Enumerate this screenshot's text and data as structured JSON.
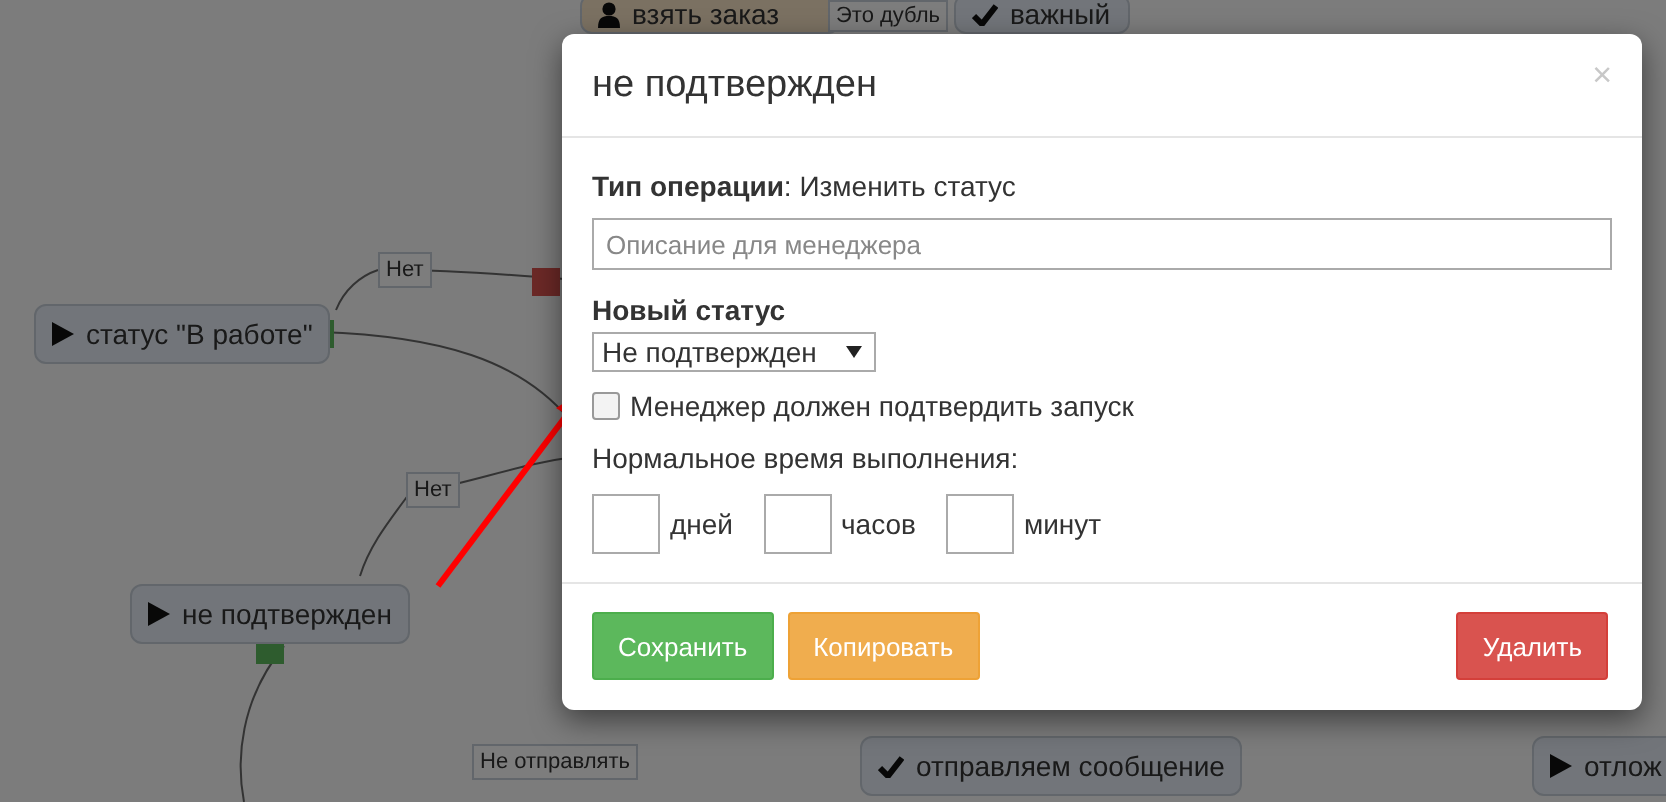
{
  "canvas": {
    "nodes": [
      {
        "kind": "user",
        "label": "взять заказ"
      },
      {
        "kind": "tag",
        "label": "Это дубль"
      },
      {
        "kind": "check",
        "label": "важный"
      },
      {
        "kind": "tag",
        "label": "Нет"
      },
      {
        "kind": "play",
        "label": "статус \"В работе\""
      },
      {
        "kind": "tag",
        "label": "Нет"
      },
      {
        "kind": "play",
        "label": "не подтвержден"
      },
      {
        "kind": "tag",
        "label": "Не отправлять"
      },
      {
        "kind": "check",
        "label": "отправляем сообщение"
      },
      {
        "kind": "play",
        "label": "отлож"
      }
    ]
  },
  "modal": {
    "title": "не подтвержден",
    "close": "×",
    "operation": "**Тип операции**: Изменить статус",
    "description": {
      "placeholder": "Описание для менеджера"
    },
    "new_status": {
      "label": "Новый статус",
      "value": "Не подтвержден"
    },
    "confirm": {
      "label": "Менеджер должен подтвердить запуск",
      "checked": false
    },
    "duration": {
      "label": "Нормальное время выполнения:",
      "fields": [
        {
          "unit": "дней"
        },
        {
          "unit": "часов"
        },
        {
          "unit": "минут"
        }
      ]
    },
    "buttons": [
      {
        "label": "Сохранить",
        "kind": "success"
      },
      {
        "label": "Копировать",
        "kind": "warning"
      },
      {
        "label": "Удалить",
        "kind": "danger"
      }
    ]
  }
}
